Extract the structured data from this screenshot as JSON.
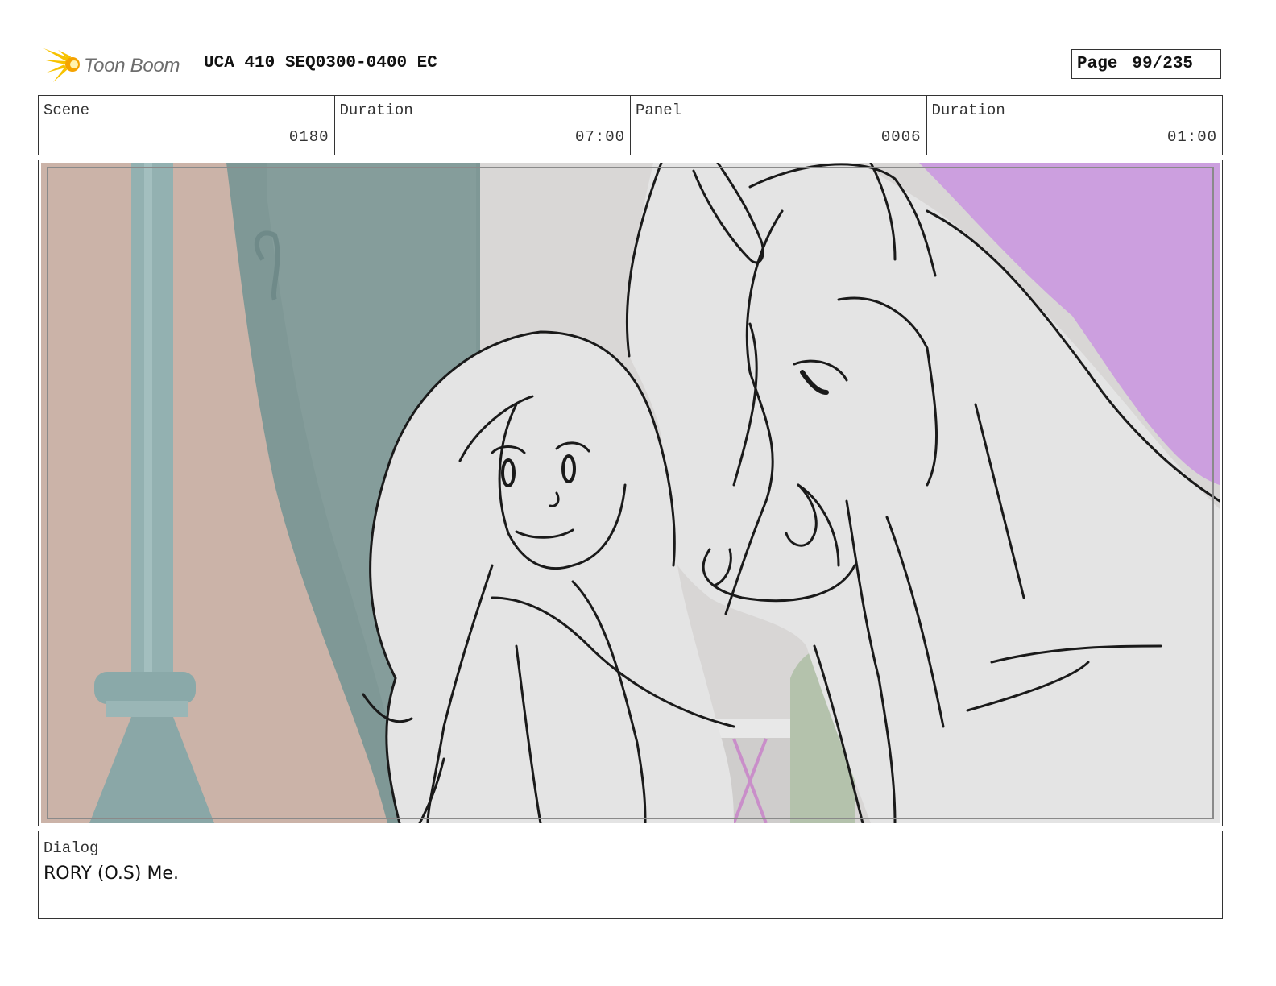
{
  "header": {
    "logo_text": "Toon Boom",
    "title": "UCA 410 SEQ0300-0400 EC",
    "page_label": "Page",
    "page_value": "99/235"
  },
  "info": {
    "scene_label": "Scene",
    "scene_value": "0180",
    "scene_duration_label": "Duration",
    "scene_duration_value": "07:00",
    "panel_label": "Panel",
    "panel_value": "0006",
    "panel_duration_label": "Duration",
    "panel_duration_value": "01:00"
  },
  "dialog": {
    "label": "Dialog",
    "text": "RORY (O.S) Me."
  },
  "colors": {
    "wall_pink": "#cfb3a6",
    "teal_dark": "#7e9795",
    "sky_purple": "#cc9fdf",
    "sketch_fill": "#e5e5e5",
    "ink": "#1a1a1a"
  }
}
